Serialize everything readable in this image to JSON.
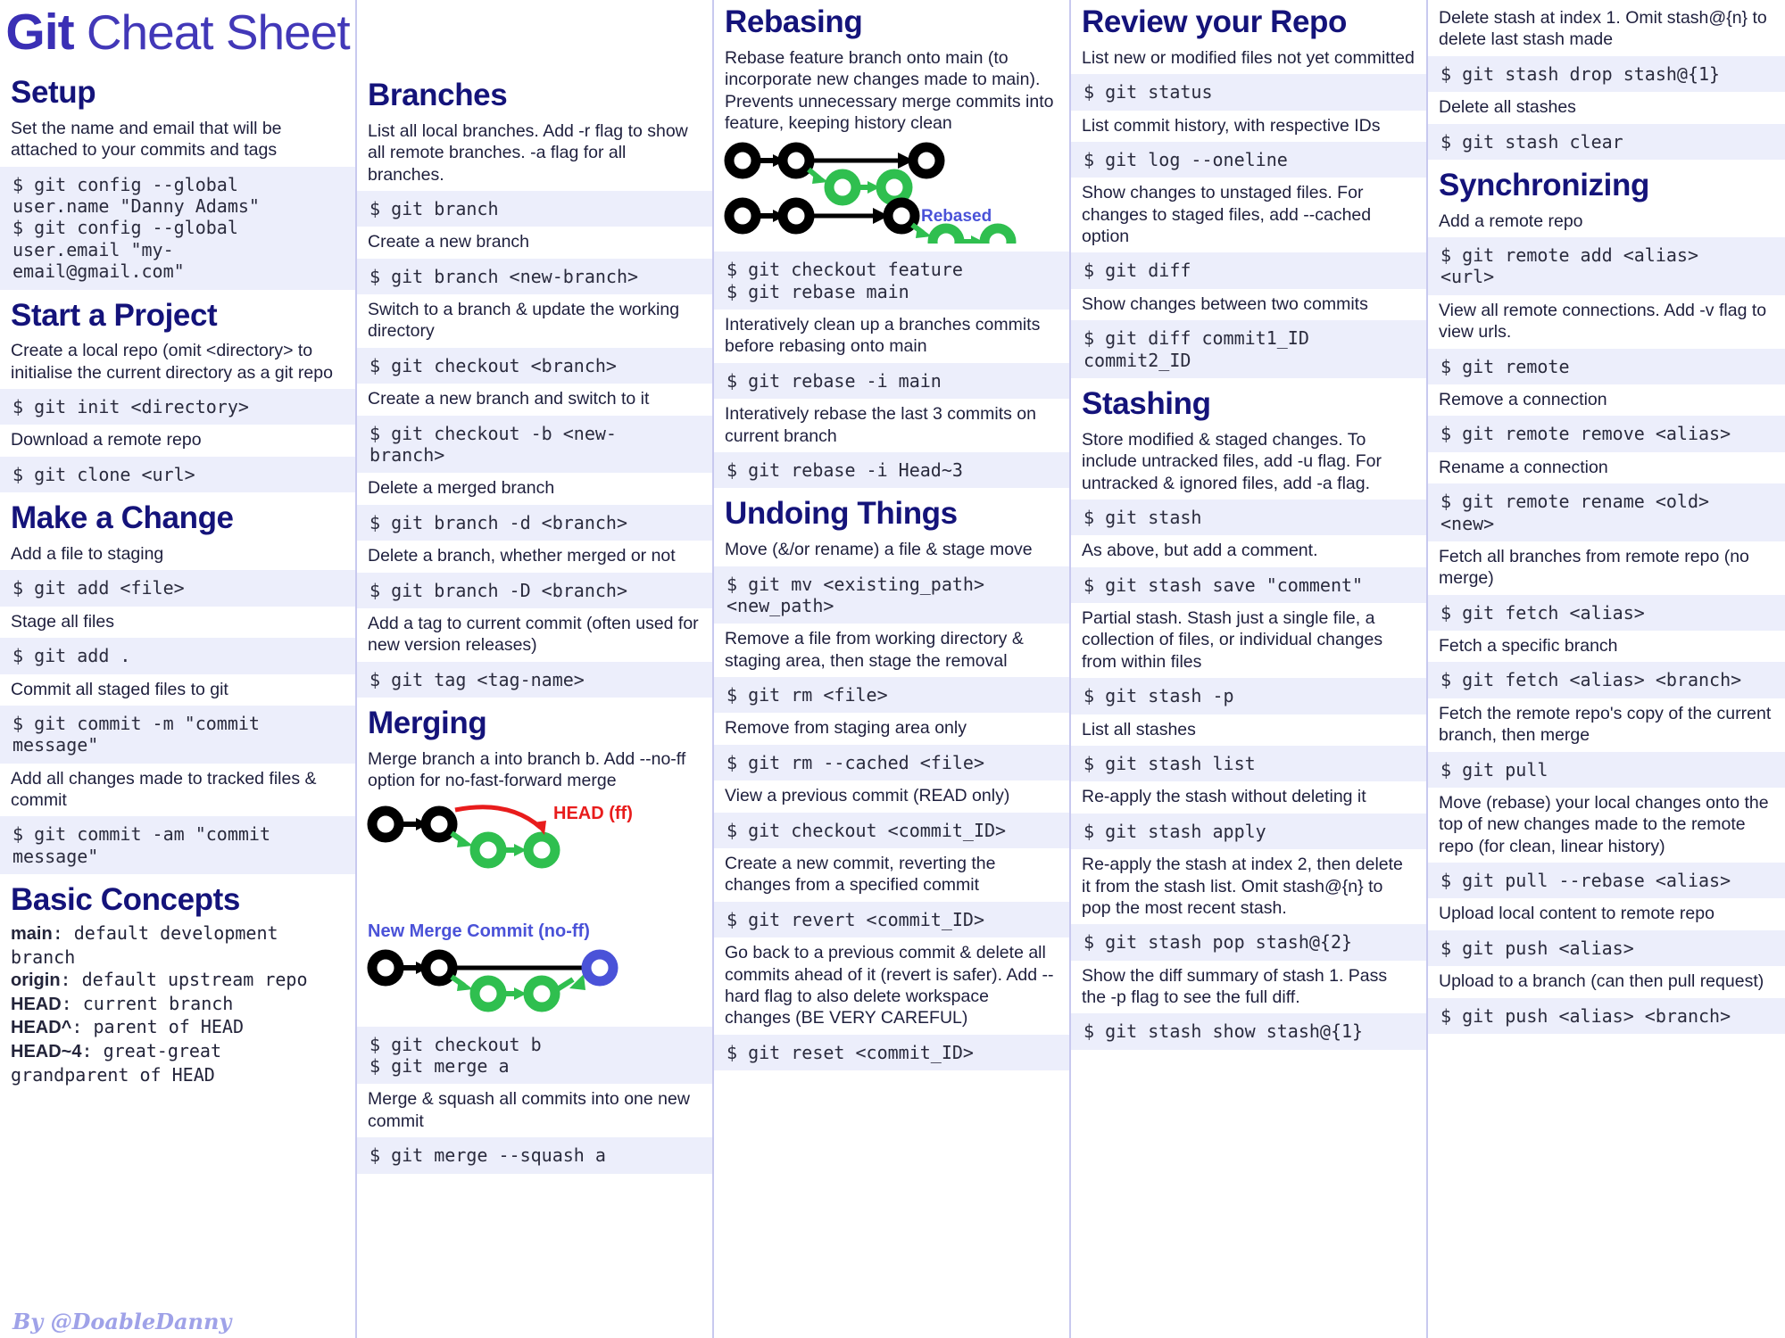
{
  "title": {
    "bold": "Git",
    "light": " Cheat Sheet"
  },
  "byline": "By @DoableDanny",
  "colors": {
    "title_bold": "#3a2fb5",
    "title_light": "#4238b8",
    "heading": "#14137a",
    "command_bg": "#eceefb",
    "command_text": "#2a2b3d",
    "body_text": "#1e1f3d",
    "divider": "#c8c9ef",
    "diagram_green": "#2fbf4f",
    "diagram_black": "#000000",
    "diagram_red": "#e81c1c",
    "diagram_blue": "#4a52d8",
    "byline": "#9fa2e8"
  },
  "sections": {
    "setup": {
      "heading": "Setup",
      "rows": [
        {
          "type": "desc",
          "text": "Set the name and email that will be attached to your commits and tags"
        },
        {
          "type": "cmd",
          "text": "$ git config --global\nuser.name \"Danny Adams\"\n$ git config --global\nuser.email \"my-\nemail@gmail.com\""
        }
      ]
    },
    "start_a_project": {
      "heading": "Start a Project",
      "rows": [
        {
          "type": "desc",
          "text": "Create a local repo (omit <directory> to initialise the current directory as a git repo"
        },
        {
          "type": "cmd",
          "text": "$ git init <directory>"
        },
        {
          "type": "desc",
          "text": "Download a remote repo"
        },
        {
          "type": "cmd",
          "text": "$ git clone <url>"
        }
      ]
    },
    "make_a_change": {
      "heading": "Make a Change",
      "rows": [
        {
          "type": "desc",
          "text": "Add a file to staging"
        },
        {
          "type": "cmd",
          "text": "$ git add <file>"
        },
        {
          "type": "desc",
          "text": "Stage all files"
        },
        {
          "type": "cmd",
          "text": "$ git add ."
        },
        {
          "type": "desc",
          "text": "Commit all staged files to git"
        },
        {
          "type": "cmd",
          "text": "$ git commit -m \"commit\nmessage\""
        },
        {
          "type": "desc",
          "text": "Add all changes made to tracked files & commit"
        },
        {
          "type": "cmd",
          "text": "$ git commit -am \"commit\nmessage\""
        }
      ]
    },
    "basic_concepts": {
      "heading": "Basic Concepts",
      "items": [
        {
          "term": "main",
          "definition": ": default development branch"
        },
        {
          "term": "origin",
          "definition": ": default upstream repo"
        },
        {
          "term": "HEAD",
          "definition": ": current branch"
        },
        {
          "term": "HEAD^",
          "definition": ": parent of HEAD"
        },
        {
          "term": "HEAD~4",
          "definition": ": great-great grandparent of HEAD"
        }
      ]
    },
    "branches": {
      "heading": "Branches",
      "rows": [
        {
          "type": "desc",
          "text": "List all local branches. Add -r flag to show all remote branches. -a flag for all branches."
        },
        {
          "type": "cmd",
          "text": "$ git branch"
        },
        {
          "type": "desc",
          "text": "Create a new branch"
        },
        {
          "type": "cmd",
          "text": "$ git branch <new-branch>"
        },
        {
          "type": "desc",
          "text": "Switch to a branch & update the working directory"
        },
        {
          "type": "cmd",
          "text": "$ git checkout <branch>"
        },
        {
          "type": "desc",
          "text": "Create a new branch and switch to it"
        },
        {
          "type": "cmd",
          "text": "$ git checkout -b <new-\nbranch>"
        },
        {
          "type": "desc",
          "text": "Delete a merged branch"
        },
        {
          "type": "cmd",
          "text": "$ git branch -d <branch>"
        },
        {
          "type": "desc",
          "text": "Delete a branch, whether merged or not"
        },
        {
          "type": "cmd",
          "text": "$ git branch -D <branch>"
        },
        {
          "type": "desc",
          "text": "Add a tag to current commit (often used for new version releases)"
        },
        {
          "type": "cmd",
          "text": "$ git tag <tag-name>"
        }
      ]
    },
    "merging": {
      "heading": "Merging",
      "rows": [
        {
          "type": "desc",
          "text": "Merge branch a into branch b. Add --no-ff option for no-fast-forward merge"
        },
        {
          "type": "diagram",
          "name": "merge-diagram",
          "labels": {
            "ff": "HEAD (ff)",
            "noff": "New Merge Commit (no-ff)"
          }
        },
        {
          "type": "cmd",
          "text": "$ git checkout b\n$ git merge a"
        },
        {
          "type": "desc",
          "text": "Merge & squash all commits into one new commit"
        },
        {
          "type": "cmd",
          "text": "$ git merge --squash a"
        }
      ]
    },
    "rebasing": {
      "heading": "Rebasing",
      "rows": [
        {
          "type": "desc",
          "text": "Rebase feature branch onto main (to incorporate new changes made to main). Prevents unnecessary merge commits into feature, keeping history clean"
        },
        {
          "type": "diagram",
          "name": "rebase-diagram",
          "labels": {
            "rebased": "Rebased"
          }
        },
        {
          "type": "cmd",
          "text": "$ git checkout feature\n$ git rebase main"
        },
        {
          "type": "desc",
          "text": "Interatively clean up a branches commits before rebasing onto main"
        },
        {
          "type": "cmd",
          "text": "$ git rebase -i main"
        },
        {
          "type": "desc",
          "text": "Interatively rebase the last 3 commits on current branch"
        },
        {
          "type": "cmd",
          "text": "$ git rebase -i Head~3"
        }
      ]
    },
    "undoing_things": {
      "heading": "Undoing Things",
      "rows": [
        {
          "type": "desc",
          "text": "Move (&/or rename) a file & stage move"
        },
        {
          "type": "cmd",
          "text": "$ git mv <existing_path>\n<new_path>"
        },
        {
          "type": "desc",
          "text": "Remove a file from working directory & staging area, then stage the removal"
        },
        {
          "type": "cmd",
          "text": "$ git rm <file>"
        },
        {
          "type": "desc",
          "text": "Remove from staging area only"
        },
        {
          "type": "cmd",
          "text": "$ git rm --cached <file>"
        },
        {
          "type": "desc",
          "text": "View a previous commit (READ only)"
        },
        {
          "type": "cmd",
          "text": "$ git checkout <commit_ID>"
        },
        {
          "type": "desc",
          "text": "Create a new commit, reverting the changes from a specified commit"
        },
        {
          "type": "cmd",
          "text": "$ git revert <commit_ID>"
        },
        {
          "type": "desc",
          "text": "Go back to a previous commit & delete all commits ahead of it (revert is safer). Add --hard flag to also delete workspace changes (BE VERY CAREFUL)"
        },
        {
          "type": "cmd",
          "text": "$ git reset <commit_ID>"
        }
      ]
    },
    "review_your_repo": {
      "heading": "Review your Repo",
      "rows": [
        {
          "type": "desc",
          "text": "List new or modified files not yet committed"
        },
        {
          "type": "cmd",
          "text": "$ git status"
        },
        {
          "type": "desc",
          "text": "List commit history, with respective IDs"
        },
        {
          "type": "cmd",
          "text": "$ git log --oneline"
        },
        {
          "type": "desc",
          "text": "Show changes to unstaged files. For changes to staged files, add --cached option"
        },
        {
          "type": "cmd",
          "text": "$ git diff"
        },
        {
          "type": "desc",
          "text": "Show changes between two commits"
        },
        {
          "type": "cmd",
          "text": "$ git diff commit1_ID\ncommit2_ID"
        }
      ]
    },
    "stashing": {
      "heading": "Stashing",
      "rows": [
        {
          "type": "desc",
          "text": "Store modified & staged changes. To include untracked files, add -u flag. For untracked & ignored files, add -a flag."
        },
        {
          "type": "cmd",
          "text": "$ git stash"
        },
        {
          "type": "desc",
          "text": "As above, but add a comment."
        },
        {
          "type": "cmd",
          "text": "$ git stash save \"comment\""
        },
        {
          "type": "desc",
          "text": "Partial stash. Stash just a single file, a collection of files, or individual changes from within files"
        },
        {
          "type": "cmd",
          "text": "$ git stash -p"
        },
        {
          "type": "desc",
          "text": "List all stashes"
        },
        {
          "type": "cmd",
          "text": "$ git stash list"
        },
        {
          "type": "desc",
          "text": "Re-apply the stash without deleting it"
        },
        {
          "type": "cmd",
          "text": "$ git stash apply"
        },
        {
          "type": "desc",
          "text": "Re-apply the stash at index 2, then delete it from the stash list. Omit stash@{n} to pop the most recent stash."
        },
        {
          "type": "cmd",
          "text": "$ git stash pop stash@{2}"
        },
        {
          "type": "desc",
          "text": "Show the diff summary of stash 1. Pass the -p flag to see the full diff."
        },
        {
          "type": "cmd",
          "text": "$ git stash show stash@{1}"
        }
      ]
    },
    "stashing_cont": {
      "rows": [
        {
          "type": "desc",
          "text": "Delete stash at index 1. Omit stash@{n} to delete last stash made"
        },
        {
          "type": "cmd",
          "text": "$ git stash drop stash@{1}"
        },
        {
          "type": "desc",
          "text": "Delete all stashes"
        },
        {
          "type": "cmd",
          "text": "$ git stash clear"
        }
      ]
    },
    "synchronizing": {
      "heading": "Synchronizing",
      "rows": [
        {
          "type": "desc",
          "text": "Add a remote repo"
        },
        {
          "type": "cmd",
          "text": "$ git remote add <alias>\n<url>"
        },
        {
          "type": "desc",
          "text": "View all remote connections. Add -v flag to view urls."
        },
        {
          "type": "cmd",
          "text": "$ git remote"
        },
        {
          "type": "desc",
          "text": "Remove a connection"
        },
        {
          "type": "cmd",
          "text": "$ git remote remove <alias>"
        },
        {
          "type": "desc",
          "text": "Rename a connection"
        },
        {
          "type": "cmd",
          "text": "$ git remote rename <old>\n<new>"
        },
        {
          "type": "desc",
          "text": "Fetch all branches from remote repo (no merge)"
        },
        {
          "type": "cmd",
          "text": "$ git fetch <alias>"
        },
        {
          "type": "desc",
          "text": "Fetch a specific branch"
        },
        {
          "type": "cmd",
          "text": "$ git fetch <alias> <branch>"
        },
        {
          "type": "desc",
          "text": "Fetch the remote repo's copy of the current branch, then merge"
        },
        {
          "type": "cmd",
          "text": "$ git pull"
        },
        {
          "type": "desc",
          "text": "Move (rebase) your local changes onto the top of new changes made to the remote repo (for clean, linear history)"
        },
        {
          "type": "cmd",
          "text": "$ git pull --rebase <alias>"
        },
        {
          "type": "desc",
          "text": "Upload local content to remote repo"
        },
        {
          "type": "cmd",
          "text": "$ git push <alias>"
        },
        {
          "type": "desc",
          "text": "Upload to a branch (can then pull request)"
        },
        {
          "type": "cmd",
          "text": "$ git push <alias> <branch>"
        }
      ]
    }
  }
}
